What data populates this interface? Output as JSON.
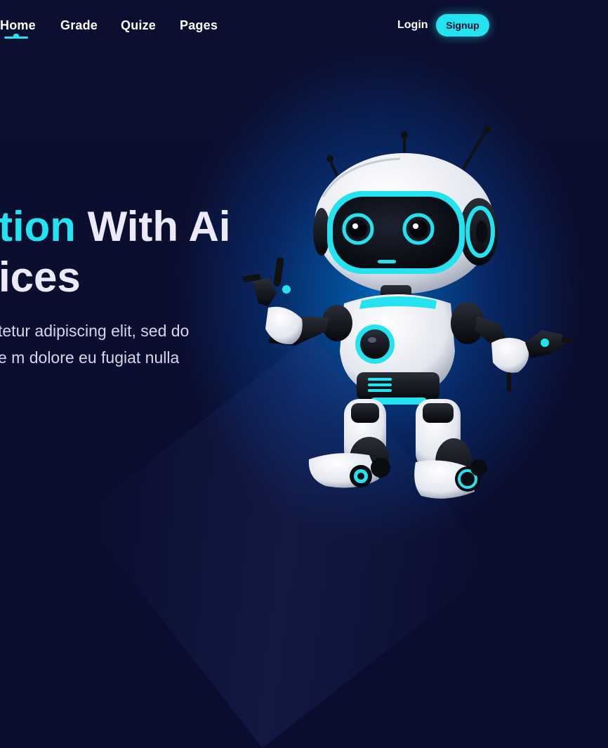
{
  "nav": {
    "items": [
      {
        "label": "Home",
        "active": true
      },
      {
        "label": "Grade"
      },
      {
        "label": "Quize"
      },
      {
        "label": "Pages"
      }
    ],
    "login_label": "Login",
    "signup_label": "Signup"
  },
  "hero": {
    "title_accent": "tion",
    "title_rest": " With Ai",
    "title_line2": "ices",
    "desc_line1": "tetur adipiscing elit, sed do",
    "desc_line2": "e m dolore eu fugiat nulla"
  },
  "colors": {
    "accent": "#22e3ef",
    "background": "#0a0d2e",
    "glow": "#0a6ec8",
    "text": "#eceaf8"
  },
  "icons": [
    "robot-illustration"
  ]
}
